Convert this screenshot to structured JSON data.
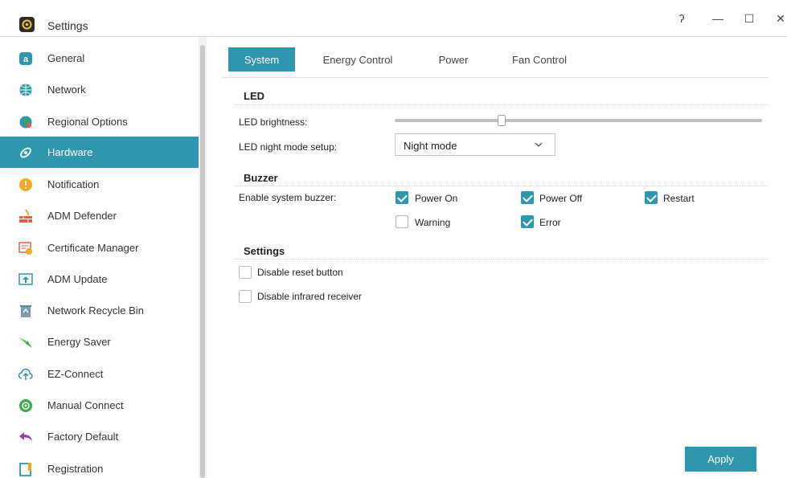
{
  "window": {
    "title": "Settings",
    "controls": {
      "help": "ʔ",
      "minimize": "—",
      "maximize": "☐",
      "close": "✕"
    }
  },
  "sidebar": {
    "items": [
      {
        "label": "General",
        "icon": "general-icon",
        "color": "#2e96ad"
      },
      {
        "label": "Network",
        "icon": "globe-icon",
        "color": "#2e96ad"
      },
      {
        "label": "Regional Options",
        "icon": "regional-icon",
        "color": "#2e96ad"
      },
      {
        "label": "Hardware",
        "icon": "hardware-icon",
        "color": "#ffffff",
        "active": true
      },
      {
        "label": "Notification",
        "icon": "notification-icon",
        "color": "#f5a623"
      },
      {
        "label": "ADM Defender",
        "icon": "firewall-icon",
        "color": "#e85d3f"
      },
      {
        "label": "Certificate Manager",
        "icon": "certificate-icon",
        "color": "#e85d3f"
      },
      {
        "label": "ADM Update",
        "icon": "update-icon",
        "color": "#2e96ad"
      },
      {
        "label": "Network Recycle Bin",
        "icon": "recycle-bin-icon",
        "color": "#7ca0a8"
      },
      {
        "label": "Energy Saver",
        "icon": "energy-icon",
        "color": "#3aa845"
      },
      {
        "label": "EZ-Connect",
        "icon": "cloud-upload-icon",
        "color": "#2e96ad"
      },
      {
        "label": "Manual Connect",
        "icon": "manual-connect-icon",
        "color": "#3aa845"
      },
      {
        "label": "Factory Default",
        "icon": "undo-icon",
        "color": "#8e44ad"
      },
      {
        "label": "Registration",
        "icon": "registration-icon",
        "color": "#2e96ad"
      }
    ]
  },
  "tabs": [
    {
      "label": "System",
      "active": true
    },
    {
      "label": "Energy Control"
    },
    {
      "label": "Power"
    },
    {
      "label": "Fan Control"
    }
  ],
  "led": {
    "section_title": "LED",
    "brightness_label": "LED brightness:",
    "brightness_value": 0.29,
    "night_mode_label": "LED night mode setup:",
    "night_mode_value": "Night mode"
  },
  "buzzer": {
    "section_title": "Buzzer",
    "label": "Enable system buzzer:",
    "options": [
      {
        "label": "Power On",
        "checked": true
      },
      {
        "label": "Power Off",
        "checked": true
      },
      {
        "label": "Restart",
        "checked": true
      },
      {
        "label": "Warning",
        "checked": false
      },
      {
        "label": "Error",
        "checked": true
      }
    ]
  },
  "settings": {
    "section_title": "Settings",
    "options": [
      {
        "label": "Disable reset button",
        "checked": false
      },
      {
        "label": "Disable infrared receiver",
        "checked": false
      }
    ]
  },
  "apply_label": "Apply",
  "colors": {
    "accent": "#2e96ad"
  }
}
